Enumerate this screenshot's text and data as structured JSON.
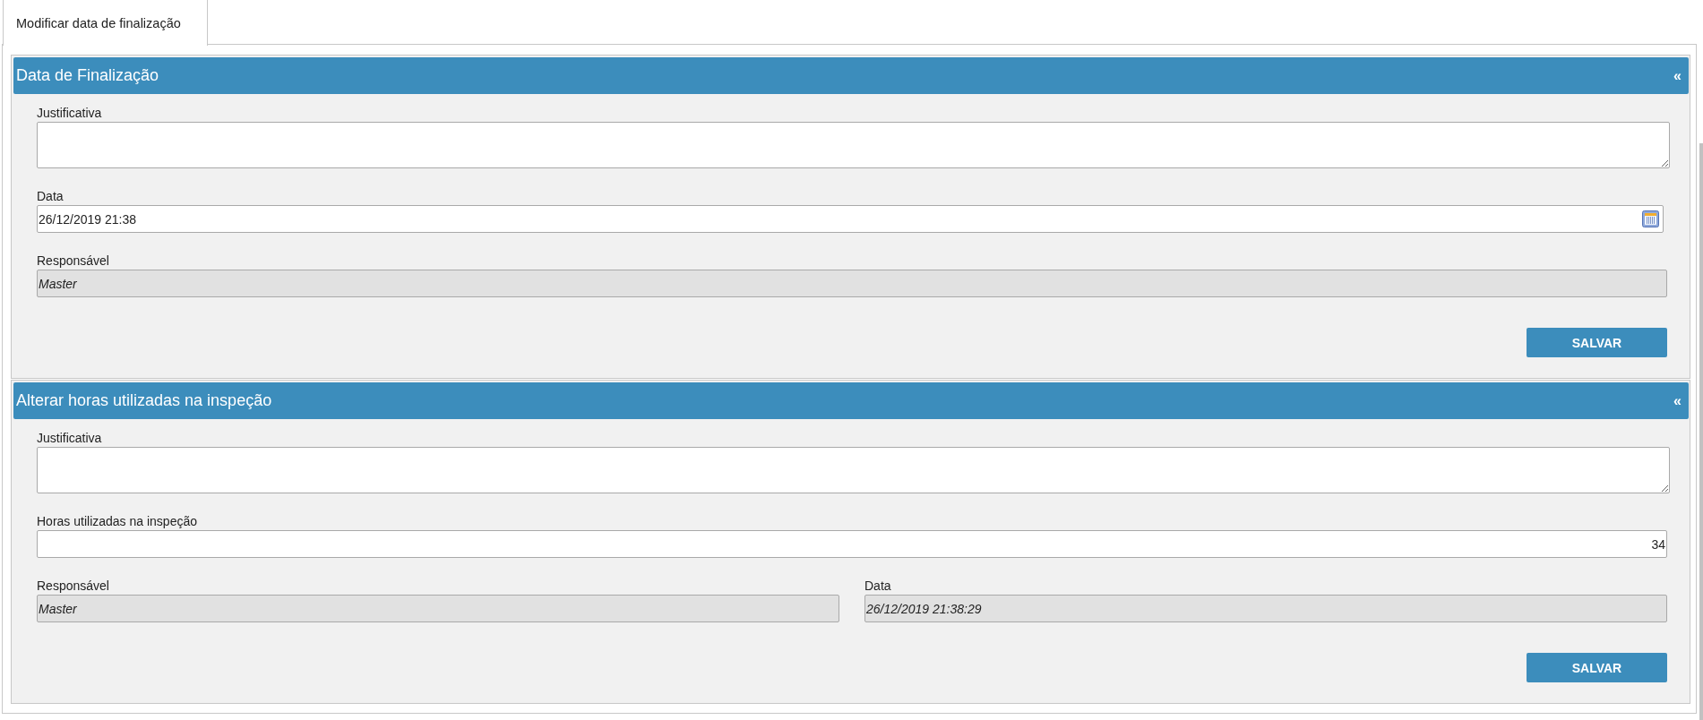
{
  "tabs": [
    {
      "label": "Modificar data de finalização",
      "selected": true
    }
  ],
  "sections": [
    {
      "title": "Data de Finalização",
      "toggle": "«",
      "rows": [
        [
          {
            "kind": "textarea",
            "label": "Justificativa"
          }
        ],
        [
          {
            "kind": "datetime",
            "label": "Data",
            "value": "26/12/2019 21:38"
          }
        ],
        [
          {
            "kind": "readonly",
            "label": "Responsável",
            "value": "Master"
          }
        ]
      ],
      "button": "SALVAR"
    },
    {
      "title": "Alterar horas utilizadas na inspeção",
      "toggle": "«",
      "rows": [
        [
          {
            "kind": "textarea",
            "label": "Justificativa"
          }
        ],
        [
          {
            "kind": "number",
            "label": "Horas utilizadas na inspeção",
            "value": "34"
          }
        ],
        [
          {
            "kind": "readonly",
            "label": "Responsável",
            "value": "Master"
          },
          {
            "kind": "readonly",
            "label": "Data",
            "value": "26/12/2019 21:38:29"
          }
        ]
      ],
      "button": "SALVAR"
    }
  ]
}
